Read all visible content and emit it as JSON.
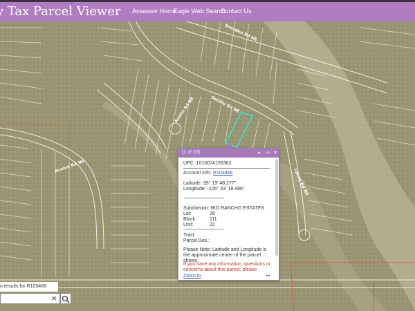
{
  "header": {
    "title": "nty Tax Parcel Viewer",
    "nav": [
      "Assessor Home",
      "Eagle Web Search",
      "Contact Us"
    ]
  },
  "map": {
    "street_labels": [
      "Sedillo Rd NE",
      "Dresden Rd NE",
      "Austin Rd NE",
      "Avalon Rd NE",
      "Laney Rd NE"
    ]
  },
  "popup": {
    "count": "(1 of 10)",
    "upc": "UPC: 1010074159363",
    "account_label": "Account Info:",
    "account_value": "R103468",
    "latitude": "Latitude: 35° 19' 48.277\"",
    "longitude": "Longitude: -106° 43' 18.486\"",
    "divider_text": "--------------------------------",
    "subdivision": "Subdivision: RIO RANCHO ESTATES",
    "lot_label": "Lot:",
    "lot_value": "26",
    "block_label": "Block:",
    "block_value": "111",
    "unit_label": "Unit:",
    "unit_value": "22",
    "tract": "Tract:",
    "parcel_des": "Parcel Des.:",
    "note": "Please Note: Latitude and Longitude is the approximate center of the parcel shown.",
    "contact_note": "If you have any information, questions or concerns about this parcel, please contact",
    "zoom_to": "Zoom to",
    "more": "•••"
  },
  "search": {
    "results_text": "n results for R103468",
    "query": "",
    "clear_glyph": "×"
  },
  "colors": {
    "header": "#b07cc2",
    "popup_header": "#a679bb",
    "parcel_outline": "#ffffff",
    "highlight": "#3ee0d8",
    "link": "#2a56b8",
    "warning_text": "#c0392b"
  }
}
